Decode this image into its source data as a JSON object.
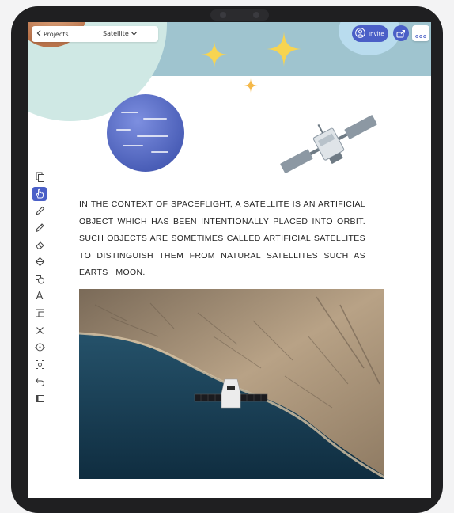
{
  "header": {
    "back_label": "Projects",
    "title": "Satellite",
    "invite_label": "Invite"
  },
  "icons": {
    "back": "chevron-left-icon",
    "title_dropdown": "chevron-down-icon",
    "invite": "user-icon",
    "share": "share-icon",
    "more": "more-icon"
  },
  "toolbar": {
    "tools": [
      {
        "name": "copy-tool",
        "active": false
      },
      {
        "name": "hand-tool",
        "active": true
      },
      {
        "name": "pen-tool",
        "active": false
      },
      {
        "name": "pencil-tool",
        "active": false
      },
      {
        "name": "eraser-tool",
        "active": false
      },
      {
        "name": "fill-tool",
        "active": false
      },
      {
        "name": "shapes-tool",
        "active": false
      },
      {
        "name": "text-tool",
        "active": false,
        "glyph": "A"
      },
      {
        "name": "image-tool",
        "active": false
      },
      {
        "name": "delete-tool",
        "active": false
      },
      {
        "name": "target-tool",
        "active": false
      },
      {
        "name": "select-tool",
        "active": false
      },
      {
        "name": "undo-tool",
        "active": false
      },
      {
        "name": "layout-tool",
        "active": false
      }
    ]
  },
  "content": {
    "paragraph": "IN THE CONTEXT OF SPACEFLIGHT, A SATELLITE IS AN ARTIFICIAL OBJECT WHICH HAS BEEN INTENTIONALLY PLACED INTO ORBIT. SUCH OBJECTS ARE SOMETIMES CALLED ARTIFICIAL SATELLITES TO DISTINGUISH THEM FROM NATURAL SATELLITES SUCH AS EARTS   MOON."
  },
  "colors": {
    "accent": "#4a5fc7",
    "top_band": "#9fc4cf",
    "mint": "#cfe8e4",
    "star": "#f7d451"
  }
}
